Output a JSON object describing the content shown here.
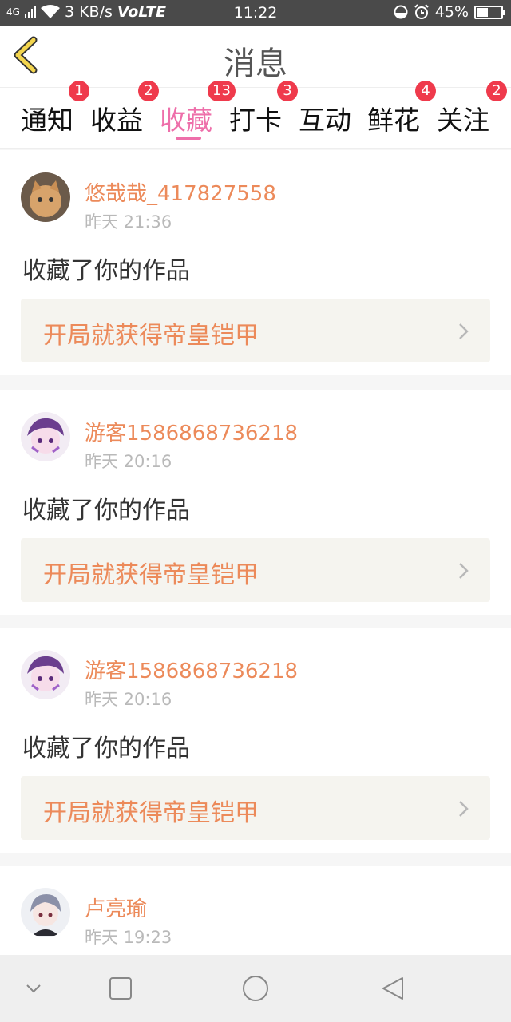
{
  "status_bar": {
    "network": "4G",
    "speed": "3 KB/s",
    "volte": "VoLTE",
    "time": "11:22",
    "battery": "45%",
    "battery_level": 0.45
  },
  "header": {
    "title": "消息",
    "back_icon": "chevron-left-icon"
  },
  "tabs": [
    {
      "label": "通知",
      "badge": "1"
    },
    {
      "label": "收益",
      "badge": "2"
    },
    {
      "label": "收藏",
      "badge": "13",
      "active": true
    },
    {
      "label": "打卡",
      "badge": "3"
    },
    {
      "label": "互动",
      "badge": ""
    },
    {
      "label": "鲜花",
      "badge": "4"
    },
    {
      "label": "关注",
      "badge": "2"
    }
  ],
  "messages": [
    {
      "user": "悠哉哉_417827558",
      "time": "昨天 21:36",
      "action": "收藏了你的作品",
      "work": "开局就获得帝皇铠甲",
      "avatar": "cat-avatar"
    },
    {
      "user": "游客1586868736218",
      "time": "昨天 20:16",
      "action": "收藏了你的作品",
      "work": "开局就获得帝皇铠甲",
      "avatar": "anime-girl-avatar"
    },
    {
      "user": "游客1586868736218",
      "time": "昨天 20:16",
      "action": "收藏了你的作品",
      "work": "开局就获得帝皇铠甲",
      "avatar": "anime-girl-avatar"
    },
    {
      "user": "卢亮瑜",
      "time": "昨天 19:23",
      "action": "",
      "work": "",
      "avatar": "anime-boy-avatar"
    }
  ],
  "colors": {
    "accent": "#ee6faa",
    "username": "#ec8a5a",
    "badge": "#ef3a4c",
    "back_icon": "#f3d54e"
  },
  "nav_bar": {
    "icons": [
      "chevron-down-icon",
      "square-icon",
      "circle-icon",
      "triangle-back-icon"
    ]
  }
}
